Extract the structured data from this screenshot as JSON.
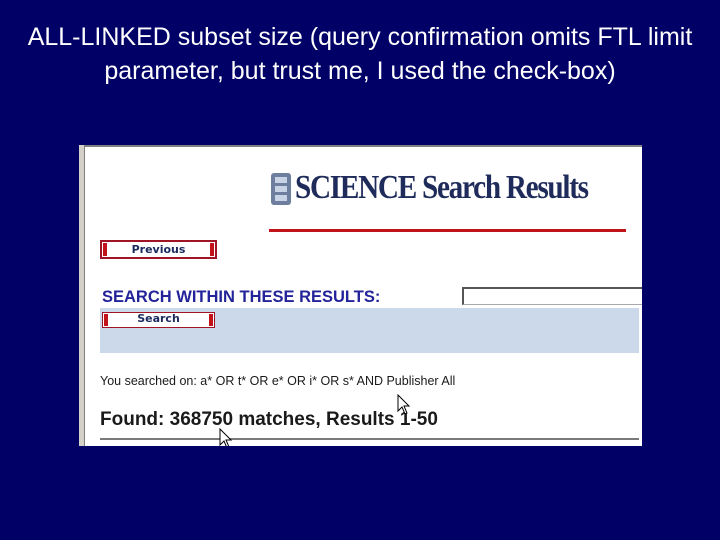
{
  "slide": {
    "title": "ALL-LINKED subset size (query confirmation omits FTL limit parameter, but trust me, I used the check-box)"
  },
  "screenshot": {
    "logo": {
      "text": "SCIENCE Search Results",
      "mark_icon": "rtf-logo-icon",
      "rule_color": "#c2121a"
    },
    "buttons": {
      "previous_label": "Previous",
      "search_label": "Search"
    },
    "search_within": {
      "label": "SEARCH WITHIN THESE RESULTS:",
      "input_value": ""
    },
    "query_summary": "You searched on: a* OR t* OR e* OR i* OR s* AND Publisher All",
    "found_text": "Found: 368750 matches, Results 1-50",
    "colors": {
      "slide_background": "#000066",
      "panel_background": "#ccd9ea",
      "label_color": "#23239a",
      "button_border": "#a01525"
    },
    "cursor_icons": [
      "arrow-cursor-icon",
      "arrow-cursor-icon"
    ]
  }
}
